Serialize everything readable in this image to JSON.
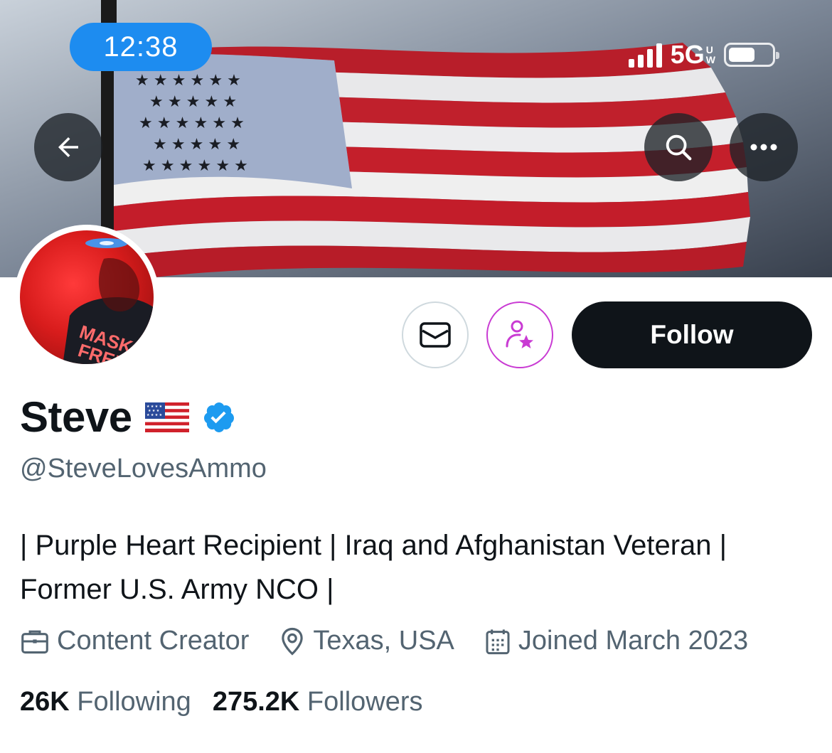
{
  "status_bar": {
    "time": "12:38",
    "network": "5G",
    "network_sup": [
      "U",
      "W"
    ]
  },
  "banner": {
    "description_icon": "american-flag-banner"
  },
  "nav": {
    "back_icon": "arrow-left-icon",
    "search_icon": "search-icon",
    "more_icon": "ellipsis-icon"
  },
  "actions": {
    "message_icon": "envelope-icon",
    "subscribe_icon": "person-star-icon",
    "follow_label": "Follow"
  },
  "profile": {
    "name": "Steve",
    "name_emoji": "us-flag-emoji",
    "verified": true,
    "handle": "@SteveLovesAmmo",
    "bio_line1": "| Purple Heart Recipient | Iraq and Afghanistan Veteran |",
    "bio_line2": "Former U.S. Army NCO |",
    "category": "Content Creator",
    "location": "Texas, USA",
    "joined": "Joined March 2023",
    "following_count": "26K",
    "following_label": "Following",
    "followers_count": "275.2K",
    "followers_label": "Followers"
  },
  "colors": {
    "accent": "#1d9bf0",
    "subscribe": "#c93bd3",
    "text": "#0f1419",
    "muted": "#536471"
  }
}
